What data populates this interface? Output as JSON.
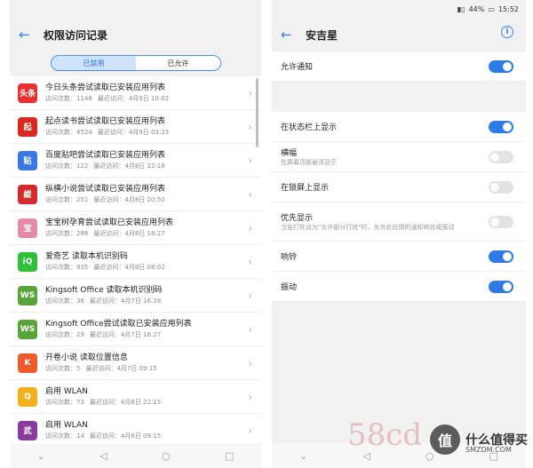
{
  "left": {
    "header": {
      "title": "权限访问记录"
    },
    "tabs": [
      {
        "label": "已禁用",
        "active": true
      },
      {
        "label": "已允许",
        "active": false
      }
    ],
    "items": [
      {
        "icon": "toutiao-icon",
        "icon_text": "头条",
        "color": "#e93030",
        "title": "今日头条尝试读取已安装应用列表",
        "count_label": "访问次数：1148",
        "last_label": "最近访问：4月9日 10:02"
      },
      {
        "icon": "qidian-icon",
        "icon_text": "起",
        "color": "#d8281f",
        "title": "起点读书尝试读取已安装应用列表",
        "count_label": "访问次数：4524",
        "last_label": "最近访问：4月9日 03:23"
      },
      {
        "icon": "tieba-icon",
        "icon_text": "贴",
        "color": "#3a78e6",
        "title": "百度贴吧尝试读取已安装应用列表",
        "count_label": "访问次数：122",
        "last_label": "最近访问：4月8日 22:18"
      },
      {
        "icon": "zongheng-icon",
        "icon_text": "縱",
        "color": "#d42c2c",
        "title": "纵横小说尝试读取已安装应用列表",
        "count_label": "访问次数：251",
        "last_label": "最近访问：4月8日 20:50"
      },
      {
        "icon": "baobaoshu-icon",
        "icon_text": "宝",
        "color": "#e58aa8",
        "title": "宝宝树孕育尝试读取已安装应用列表",
        "count_label": "访问次数：286",
        "last_label": "最近访问：4月8日 18:27"
      },
      {
        "icon": "iqiyi-icon",
        "icon_text": "iQ",
        "color": "#2fbf3a",
        "title": "爱奇艺 读取本机识别码",
        "count_label": "访问次数：935",
        "last_label": "最近访问：4月8日 08:02"
      },
      {
        "icon": "kingsoft-icon",
        "icon_text": "WS",
        "color": "#5aa53a",
        "title": "Kingsoft Office 读取本机识别码",
        "count_label": "访问次数：36",
        "last_label": "最近访问：4月7日 16:28"
      },
      {
        "icon": "kingsoft-icon",
        "icon_text": "WS",
        "color": "#5aa53a",
        "title": "Kingsoft Office尝试读取已安装应用列表",
        "count_label": "访问次数：29",
        "last_label": "最近访问：4月7日 16:27"
      },
      {
        "icon": "kaijuan-icon",
        "icon_text": "K",
        "color": "#ee5a2a",
        "title": "开卷小说 读取位置信息",
        "count_label": "访问次数：5",
        "last_label": "最近访问：4月7日 09:15"
      },
      {
        "icon": "qiyong-icon",
        "icon_text": "Q",
        "color": "#f2b21e",
        "title": "启用 WLAN",
        "count_label": "访问次数：73",
        "last_label": "最近访问：4月6日 22:15"
      },
      {
        "icon": "game-icon",
        "icon_text": "武",
        "color": "#8a3b9c",
        "title": "启用 WLAN",
        "count_label": "访问次数：14",
        "last_label": "最近访问：4月6日 09:15"
      }
    ]
  },
  "right": {
    "status": {
      "battery": "44%",
      "time": "15:52"
    },
    "header": {
      "title": "安吉星"
    },
    "settings": [
      {
        "label": "允许通知",
        "on": true
      },
      {
        "label": "在状态栏上显示",
        "on": true
      },
      {
        "label": "横幅",
        "sub": "在屏幕顶部悬浮显示",
        "on": false
      },
      {
        "label": "在锁屏上显示",
        "on": false
      },
      {
        "label": "优先显示",
        "sub": "当免打扰设为\"允许部分打扰\"时，允许此应用的通知响铃或振动",
        "on": false
      },
      {
        "label": "响铃",
        "on": true
      },
      {
        "label": "振动",
        "on": true
      }
    ]
  },
  "watermark": {
    "site": "58cd",
    "brand": "什么值得买",
    "domain": "SMZDM.COM"
  }
}
